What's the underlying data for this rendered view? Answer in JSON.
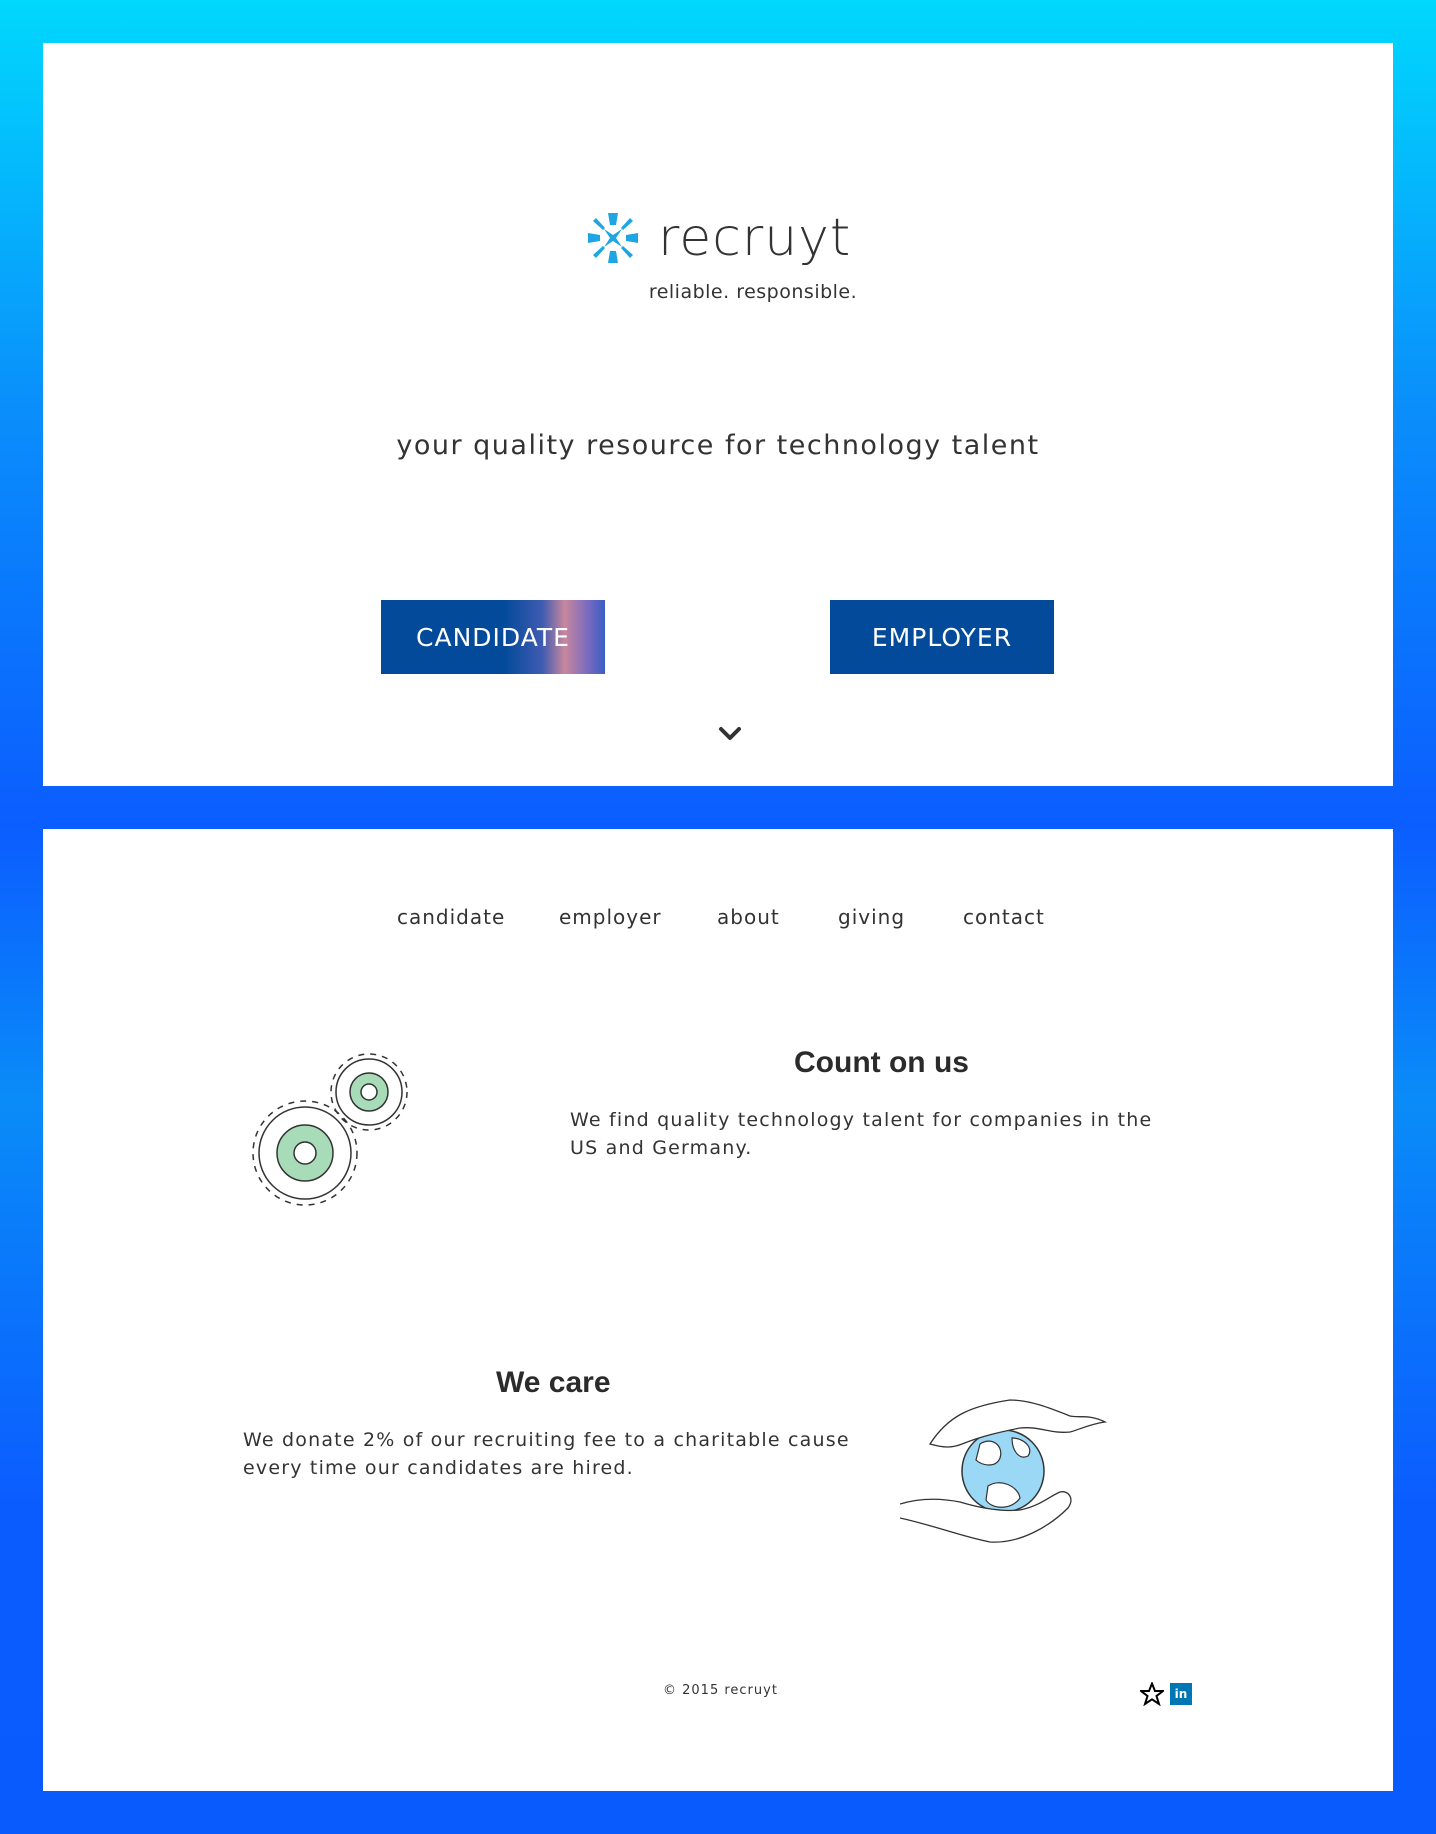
{
  "brand": {
    "name": "recruyt",
    "tagline": "reliable. responsible.",
    "subtitle": "your quality resource for technology talent",
    "logo_color": "#1da6e3"
  },
  "hero": {
    "candidate_label": "CANDIDATE",
    "employer_label": "EMPLOYER",
    "scroll_icon": "chevron-down-icon"
  },
  "nav": {
    "items": [
      "candidate",
      "employer",
      "about",
      "giving",
      "contact"
    ]
  },
  "sections": {
    "count": {
      "title": "Count on us",
      "text": "We find quality technology talent for companies in the US and Germany.",
      "icon": "gears-icon"
    },
    "care": {
      "title": "We care",
      "text": "We donate 2% of our recruiting fee to a charitable cause every time our candidates are hired.",
      "icon": "globe-hands-icon"
    }
  },
  "footer": {
    "copyright": "© 2015 recruyt",
    "social": [
      "star-icon",
      "linkedin-icon"
    ],
    "linkedin_label": "in"
  },
  "colors": {
    "button": "#034a9a",
    "gear_fill": "#a8dcb9",
    "globe_fill": "#9ad8f6",
    "linkedin": "#0077b5"
  }
}
